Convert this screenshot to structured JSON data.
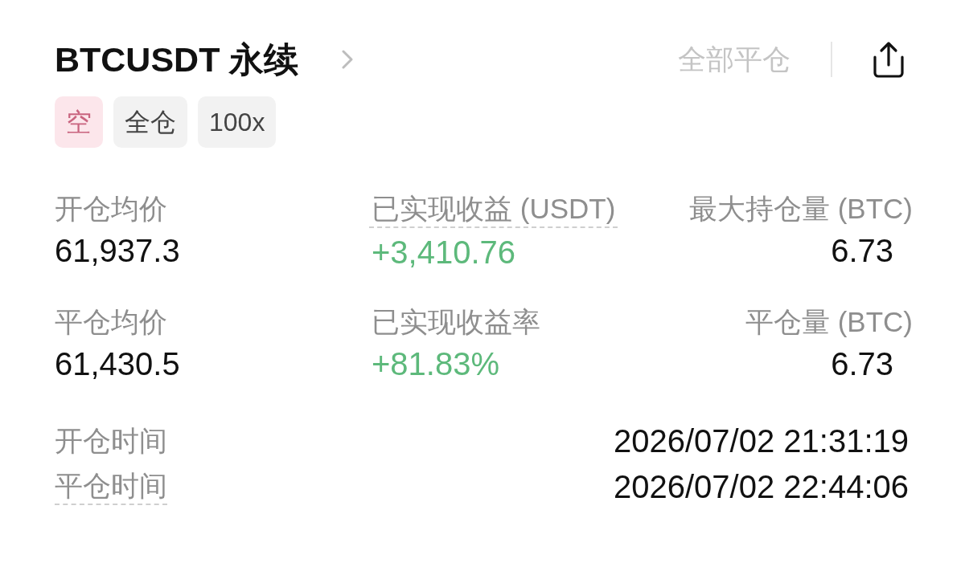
{
  "header": {
    "title": "BTCUSDT 永续",
    "close_all_button": {
      "label": "全部平仓",
      "disabled": true
    }
  },
  "tags": [
    {
      "label": "空",
      "kind": "side"
    },
    {
      "label": "全仓",
      "kind": "margin"
    },
    {
      "label": "100x",
      "kind": "leverage"
    }
  ],
  "stats": [
    {
      "label": "开仓均价",
      "value": "61,937.3",
      "color": "#111111",
      "underlined": false
    },
    {
      "label": "已实现收益 (USDT)",
      "value": "+3,410.76",
      "color": "#5db97b",
      "underlined": true
    },
    {
      "label": "最大持仓量 (BTC)",
      "value": "6.73",
      "color": "#111111",
      "underlined": false
    },
    {
      "label": "平仓均价",
      "value": "61,430.5",
      "color": "#111111",
      "underlined": false
    },
    {
      "label": "已实现收益率",
      "value": "+81.83%",
      "color": "#5db97b",
      "underlined": false
    },
    {
      "label": "平仓量 (BTC)",
      "value": "6.73",
      "color": "#111111",
      "underlined": false
    }
  ],
  "times": [
    {
      "label": "开仓时间",
      "value": "2026/07/02 21:31:19",
      "underlined": false
    },
    {
      "label": "平仓时间",
      "value": "2026/07/02 22:44:06",
      "underlined": true
    }
  ]
}
